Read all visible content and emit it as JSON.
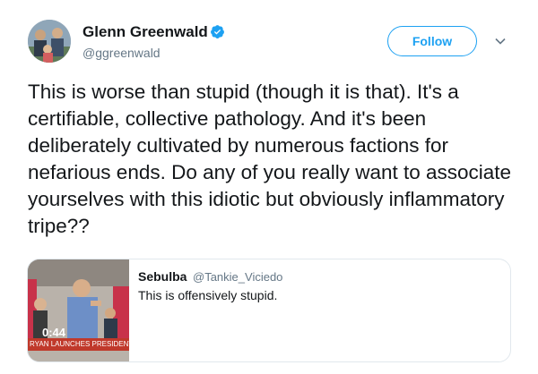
{
  "tweet": {
    "author": {
      "name": "Glenn Greenwald",
      "handle": "@ggreenwald",
      "verified": true,
      "avatar_icon": "profile-photo"
    },
    "follow_button_label": "Follow",
    "menu_icon": "chevron-down-icon",
    "text": "This is worse than stupid (though it is that). It's a certifiable, collective pathology. And it's been deliberately cultivated by numerous factions for nefarious ends. Do any of you really want to associate yourselves with this idiotic but obviously inflammatory tripe??"
  },
  "quoted_tweet": {
    "author_name": "Sebulba",
    "author_handle": "@Tankie_Viciedo",
    "text": "This is offensively stupid.",
    "video": {
      "duration": "0:44",
      "caption": "RYAN LAUNCHES PRESIDENTIAL R"
    }
  },
  "colors": {
    "accent": "#1da1f2",
    "text": "#14171a",
    "secondary_text": "#657786",
    "border": "#e1e8ed"
  }
}
